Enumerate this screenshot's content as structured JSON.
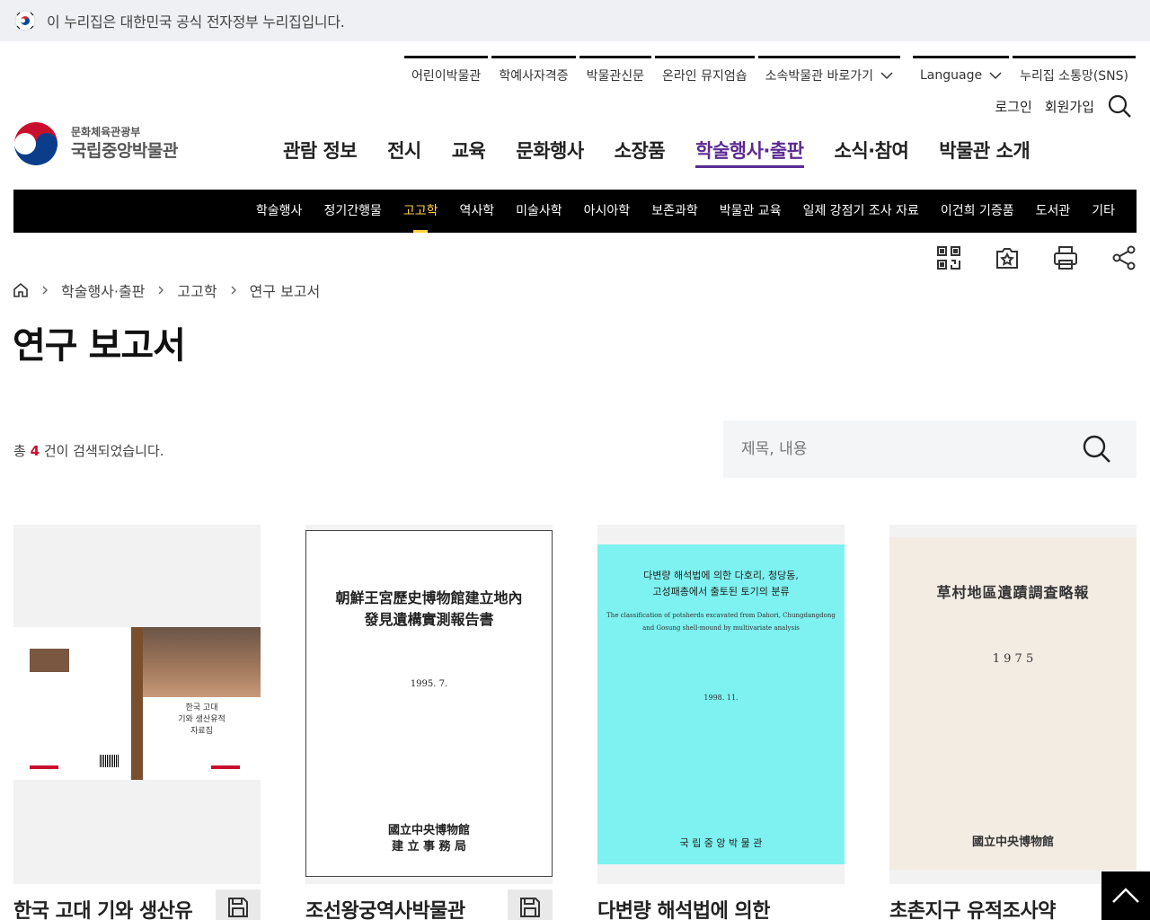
{
  "gov_banner": {
    "text": "이 누리집은 대한민국 공식 전자정부 누리집입니다."
  },
  "utility_nav": {
    "items": [
      "어린이박물관",
      "학예사자격증",
      "박물관신문",
      "온라인 뮤지엄숍",
      "소속박물관 바로가기"
    ],
    "language_label": "Language",
    "sns_label": "누리집 소통망(SNS)"
  },
  "member": {
    "login_label": "로그인",
    "join_label": "회원가입"
  },
  "logo": {
    "ministry": "문화체육관광부",
    "museum": "국립중앙박물관"
  },
  "gnb": {
    "items": [
      "관람 정보",
      "전시",
      "교육",
      "문화행사",
      "소장품",
      "학술행사·출판",
      "소식·참여",
      "박물관 소개"
    ],
    "active_index": 5
  },
  "subnav": {
    "items": [
      "학술행사",
      "정기간행물",
      "고고학",
      "역사학",
      "미술사학",
      "아시아학",
      "보존과학",
      "박물관 교육",
      "일제 강점기 조사 자료",
      "이건희 기증품",
      "도서관",
      "기타"
    ],
    "active_index": 2
  },
  "breadcrumb": {
    "items": [
      "학술행사·출판",
      "고고학",
      "연구 보고서"
    ]
  },
  "page_title": "연구 보고서",
  "results": {
    "prefix": "총",
    "count": "4",
    "suffix": "건이 검색되었습니다."
  },
  "search": {
    "placeholder": "제목, 내용"
  },
  "books": [
    {
      "title": "한국 고대 기와 생산유",
      "cover_lines": [
        "한국 고대",
        "기와 생산유적",
        "자료집"
      ]
    },
    {
      "title": "조선왕궁역사박물관",
      "cover_lines": [
        "朝鮮王宮歷史博物館建立地內",
        "發見遺構實測報告書",
        "1995. 7.",
        "國立中央博物館",
        "建 立 事 務 局"
      ]
    },
    {
      "title": "다변량 해석법에 의한",
      "cover_lines": [
        "다변량 해석법에 의한 다호리, 청당동,",
        "고성패총에서 출토된 토기의 분류",
        "The classification of potsherds excavated from Dahori, Chungdangdong",
        "and Gosung shell-mound by multivariate analysis",
        "1998. 11.",
        "국 립 중 앙 박 물 관"
      ]
    },
    {
      "title": "초촌지구 유적조사약",
      "cover_lines": [
        "草村地區遺蹟調査略報",
        "1 9 7 5",
        "國立中央博物館"
      ]
    }
  ],
  "colors": {
    "accent": "#5b2a93",
    "subnav_active": "#ffd23f",
    "count": "#c8102e",
    "cover_cyan": "#7df2f0"
  }
}
